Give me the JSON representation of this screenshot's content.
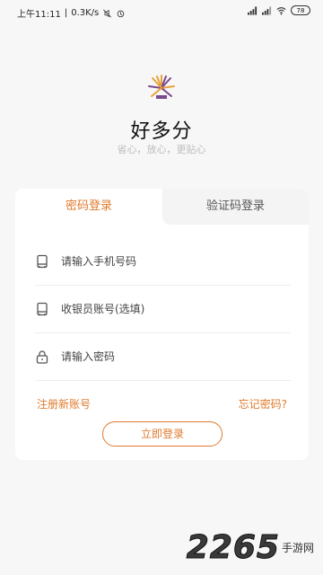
{
  "status_bar": {
    "time": "上午11:11",
    "speed": "0.3K/s",
    "battery": "78"
  },
  "app": {
    "name": "好多分",
    "slogan": "省心，放心，更贴心"
  },
  "tabs": [
    {
      "label": "密码登录",
      "active": true
    },
    {
      "label": "验证码登录",
      "active": false
    }
  ],
  "form": {
    "phone_placeholder": "请输入手机号码",
    "cashier_placeholder": "收银员账号(选填)",
    "password_placeholder": "请输入密码"
  },
  "links": {
    "register": "注册新账号",
    "forgot": "忘记密码?"
  },
  "login_button": "立即登录",
  "watermark": {
    "number": "2265",
    "text": "手游网"
  },
  "colors": {
    "accent": "#e07a2d",
    "background": "#f7f7f7"
  }
}
